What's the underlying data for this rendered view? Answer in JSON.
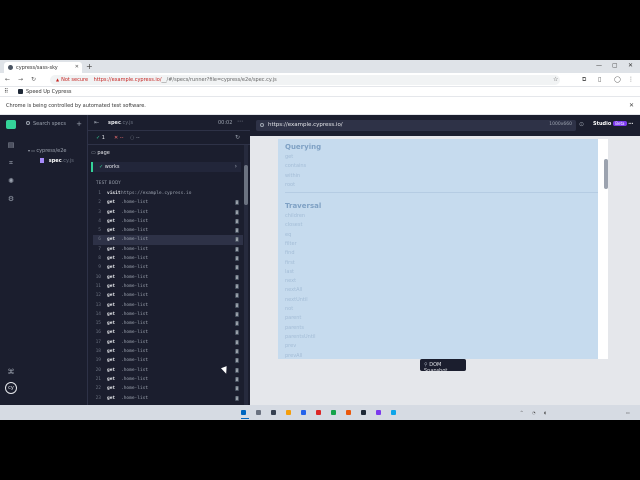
{
  "browser": {
    "tab_title": "cypress/sass-sky",
    "url_security": "Not secure",
    "url_host": "https://example.cypress.io/",
    "url_rest": "__/#/specs/runner?file=cypress/e2e/spec.cy.js",
    "bookmark": "Speed Up Cypress",
    "automation_banner": "Chrome is being controlled by automated test software."
  },
  "sidebar": {
    "search_placeholder": "Search specs",
    "folder": "cypress/e2e",
    "file_name": "spec",
    "file_ext": ".cy.js"
  },
  "reporter": {
    "spec_name": "spec",
    "spec_ext": ".cy.js",
    "elapsed": "00:02",
    "passed": "1",
    "failed": "--",
    "pending": "--",
    "suite": "page",
    "test": "works",
    "test_body_label": "TEST BODY",
    "commands": [
      {
        "n": "1",
        "k": "visit",
        "a": "https://example.cypress.io",
        "b": ""
      },
      {
        "n": "2",
        "k": "get",
        "a": ".home-list",
        "b": "8"
      },
      {
        "n": "3",
        "k": "get",
        "a": ".home-list",
        "b": "8"
      },
      {
        "n": "4",
        "k": "get",
        "a": ".home-list",
        "b": "8"
      },
      {
        "n": "5",
        "k": "get",
        "a": ".home-list",
        "b": "8"
      },
      {
        "n": "6",
        "k": "get",
        "a": ".home-list",
        "b": "8"
      },
      {
        "n": "7",
        "k": "get",
        "a": ".home-list",
        "b": "8"
      },
      {
        "n": "8",
        "k": "get",
        "a": ".home-list",
        "b": "8"
      },
      {
        "n": "9",
        "k": "get",
        "a": ".home-list",
        "b": "8"
      },
      {
        "n": "10",
        "k": "get",
        "a": ".home-list",
        "b": "8"
      },
      {
        "n": "11",
        "k": "get",
        "a": ".home-list",
        "b": "8"
      },
      {
        "n": "12",
        "k": "get",
        "a": ".home-list",
        "b": "8"
      },
      {
        "n": "13",
        "k": "get",
        "a": ".home-list",
        "b": "8"
      },
      {
        "n": "14",
        "k": "get",
        "a": ".home-list",
        "b": "8"
      },
      {
        "n": "15",
        "k": "get",
        "a": ".home-list",
        "b": "8"
      },
      {
        "n": "16",
        "k": "get",
        "a": ".home-list",
        "b": "8"
      },
      {
        "n": "17",
        "k": "get",
        "a": ".home-list",
        "b": "8"
      },
      {
        "n": "18",
        "k": "get",
        "a": ".home-list",
        "b": "8"
      },
      {
        "n": "19",
        "k": "get",
        "a": ".home-list",
        "b": "8"
      },
      {
        "n": "20",
        "k": "get",
        "a": ".home-list",
        "b": "8"
      },
      {
        "n": "21",
        "k": "get",
        "a": ".home-list",
        "b": "8"
      },
      {
        "n": "22",
        "k": "get",
        "a": ".home-list",
        "b": "8"
      },
      {
        "n": "23",
        "k": "get",
        "a": ".home-list",
        "b": "8"
      }
    ]
  },
  "aut": {
    "url": "https://example.cypress.io/",
    "viewport": "1000x660",
    "studio_label": "Studio",
    "studio_badge": "Beta",
    "snapshot_label": "DOM Snapshot",
    "sections": [
      {
        "title": "Querying",
        "items": [
          "get",
          "contains",
          "within",
          "root"
        ]
      },
      {
        "title": "Traversal",
        "items": [
          "children",
          "closest",
          "eq",
          "filter",
          "find",
          "first",
          "last",
          "next",
          "nextAll",
          "nextUntil",
          "not",
          "parent",
          "parents",
          "parentsUntil",
          "prev",
          "prevAll"
        ]
      }
    ]
  }
}
